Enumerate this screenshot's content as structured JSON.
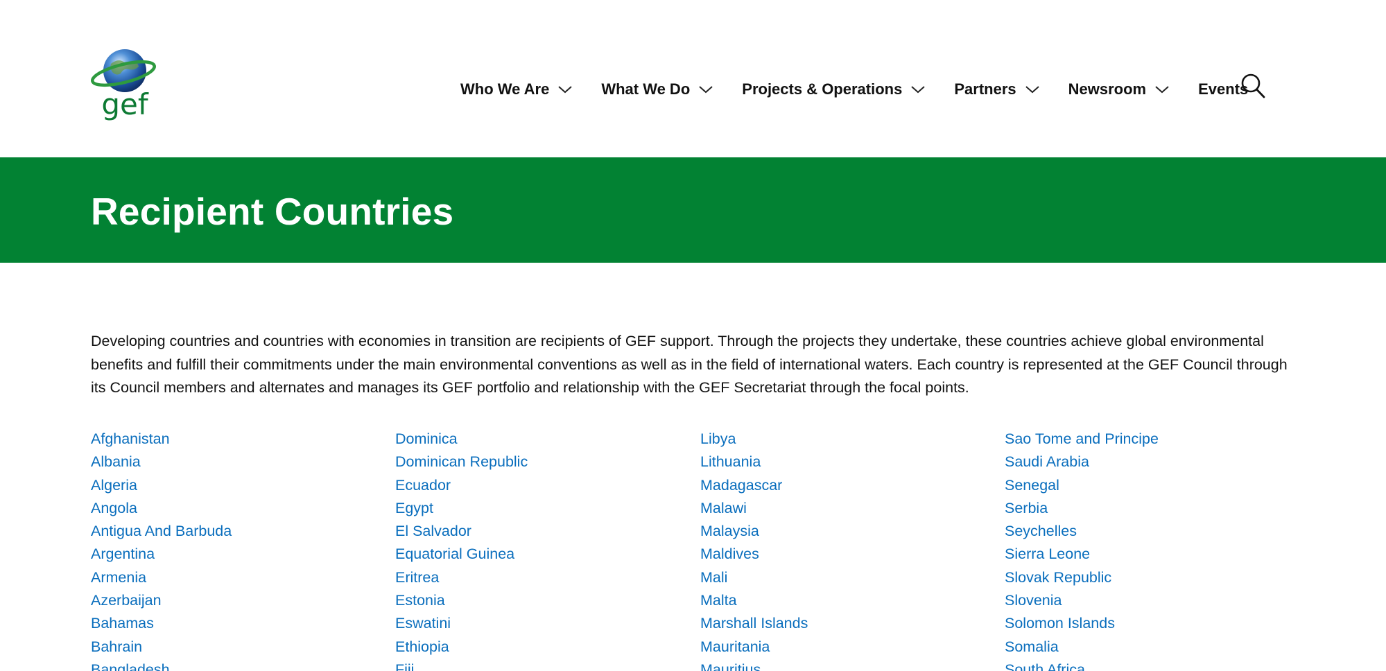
{
  "brand": {
    "logo_text": "gef",
    "logo_icon": "globe-with-ring-icon",
    "colors": {
      "green": "#028233",
      "link_blue": "#0a6ebd",
      "text": "#111111"
    }
  },
  "nav": {
    "items": [
      {
        "label": "Who We Are",
        "has_dropdown": true
      },
      {
        "label": "What We Do",
        "has_dropdown": true
      },
      {
        "label": "Projects & Operations",
        "has_dropdown": true
      },
      {
        "label": "Partners",
        "has_dropdown": true
      },
      {
        "label": "Newsroom",
        "has_dropdown": true
      },
      {
        "label": "Events",
        "has_dropdown": false
      }
    ],
    "search_icon": "search-icon"
  },
  "banner": {
    "title": "Recipient Countries"
  },
  "intro": {
    "text": "Developing countries and countries with economies in transition are recipients of GEF support. Through the projects they undertake, these countries achieve global environmental benefits and fulfill their commitments under the main environmental conventions as well as in the field of international waters. Each country is represented at the GEF Council through its Council members and alternates and manages its GEF portfolio and relationship with the GEF Secretariat through the focal points."
  },
  "countries": {
    "col1": [
      "Afghanistan",
      "Albania",
      "Algeria",
      "Angola",
      "Antigua And Barbuda",
      "Argentina",
      "Armenia",
      "Azerbaijan",
      "Bahamas",
      "Bahrain",
      "Bangladesh"
    ],
    "col2": [
      "Dominica",
      "Dominican Republic",
      "Ecuador",
      "Egypt",
      "El Salvador",
      "Equatorial Guinea",
      "Eritrea",
      "Estonia",
      "Eswatini",
      "Ethiopia",
      "Fiji"
    ],
    "col3": [
      "Libya",
      "Lithuania",
      "Madagascar",
      "Malawi",
      "Malaysia",
      "Maldives",
      "Mali",
      "Malta",
      "Marshall Islands",
      "Mauritania",
      "Mauritius"
    ],
    "col4": [
      "Sao Tome and Principe",
      "Saudi Arabia",
      "Senegal",
      "Serbia",
      "Seychelles",
      "Sierra Leone",
      "Slovak Republic",
      "Slovenia",
      "Solomon Islands",
      "Somalia",
      "South Africa"
    ]
  }
}
